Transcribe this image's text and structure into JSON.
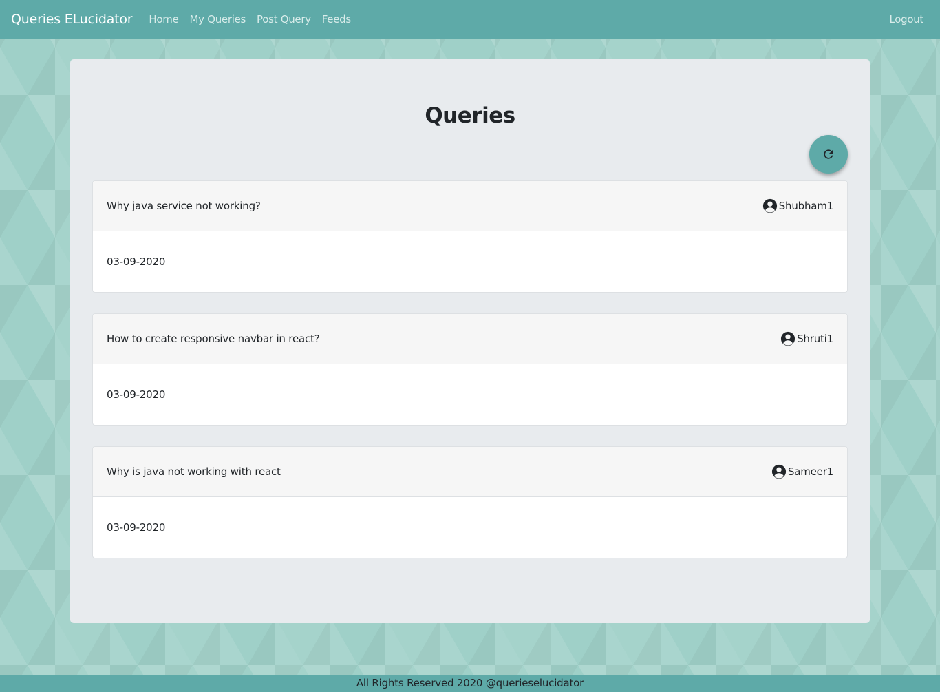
{
  "navbar": {
    "brand": "Queries ELucidator",
    "links": [
      "Home",
      "My Queries",
      "Post Query",
      "Feeds"
    ],
    "logout": "Logout"
  },
  "main": {
    "title": "Queries",
    "refresh_icon": "refresh-icon",
    "queries": [
      {
        "question": "Why java service not working?",
        "user": "Shubham1",
        "date": "03-09-2020"
      },
      {
        "question": "How to create responsive navbar in react?",
        "user": "Shruti1",
        "date": "03-09-2020"
      },
      {
        "question": "Why is java not working with react",
        "user": "Sameer1",
        "date": "03-09-2020"
      }
    ]
  },
  "footer": {
    "text": "All Rights Reserved 2020 @querieselucidator"
  },
  "colors": {
    "primary": "#5eaaa8",
    "panel": "#e8ebee",
    "background": "#9fd0c8"
  }
}
